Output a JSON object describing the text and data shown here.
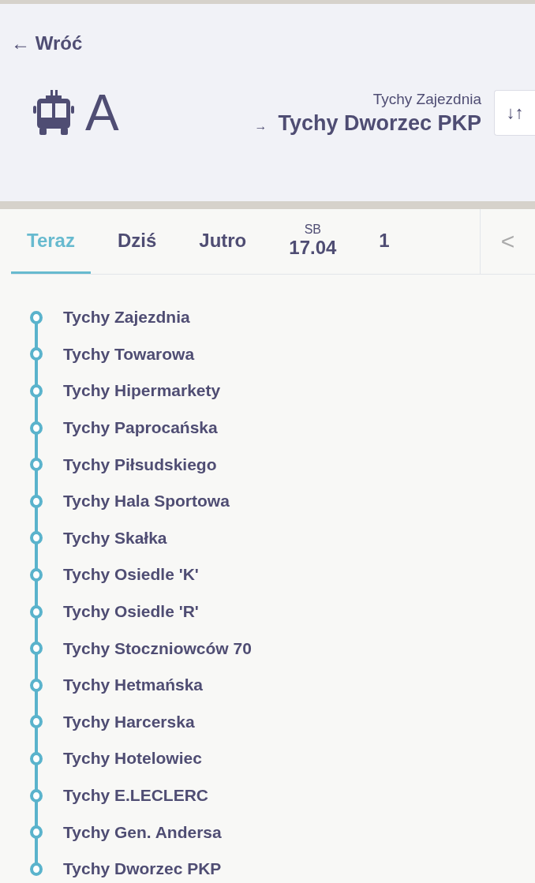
{
  "header": {
    "back": {
      "arrow": "←",
      "label": "Wróć"
    },
    "line": "A",
    "direction": {
      "from": "Tychy Zajezdnia",
      "arrow": "→",
      "to": "Tychy Dworzec PKP"
    },
    "swap_button": "↓↑"
  },
  "tabs": [
    {
      "label": "Teraz",
      "selected": true
    },
    {
      "label": "Dziś",
      "selected": false
    },
    {
      "label": "Jutro",
      "selected": false
    },
    {
      "day": "SB",
      "label": "17.04",
      "selected": false
    },
    {
      "label": "1",
      "selected": false
    }
  ],
  "scroll_button": "<",
  "stops": [
    "Tychy Zajezdnia",
    "Tychy Towarowa",
    "Tychy Hipermarkety",
    "Tychy Paprocańska",
    "Tychy Piłsudskiego",
    "Tychy Hala Sportowa",
    "Tychy Skałka",
    "Tychy Osiedle 'K'",
    "Tychy Osiedle 'R'",
    "Tychy Stoczniowców 70",
    "Tychy Hetmańska",
    "Tychy Harcerska",
    "Tychy Hotelowiec",
    "Tychy E.LECLERC",
    "Tychy Gen. Andersa",
    "Tychy Dworzec PKP"
  ]
}
